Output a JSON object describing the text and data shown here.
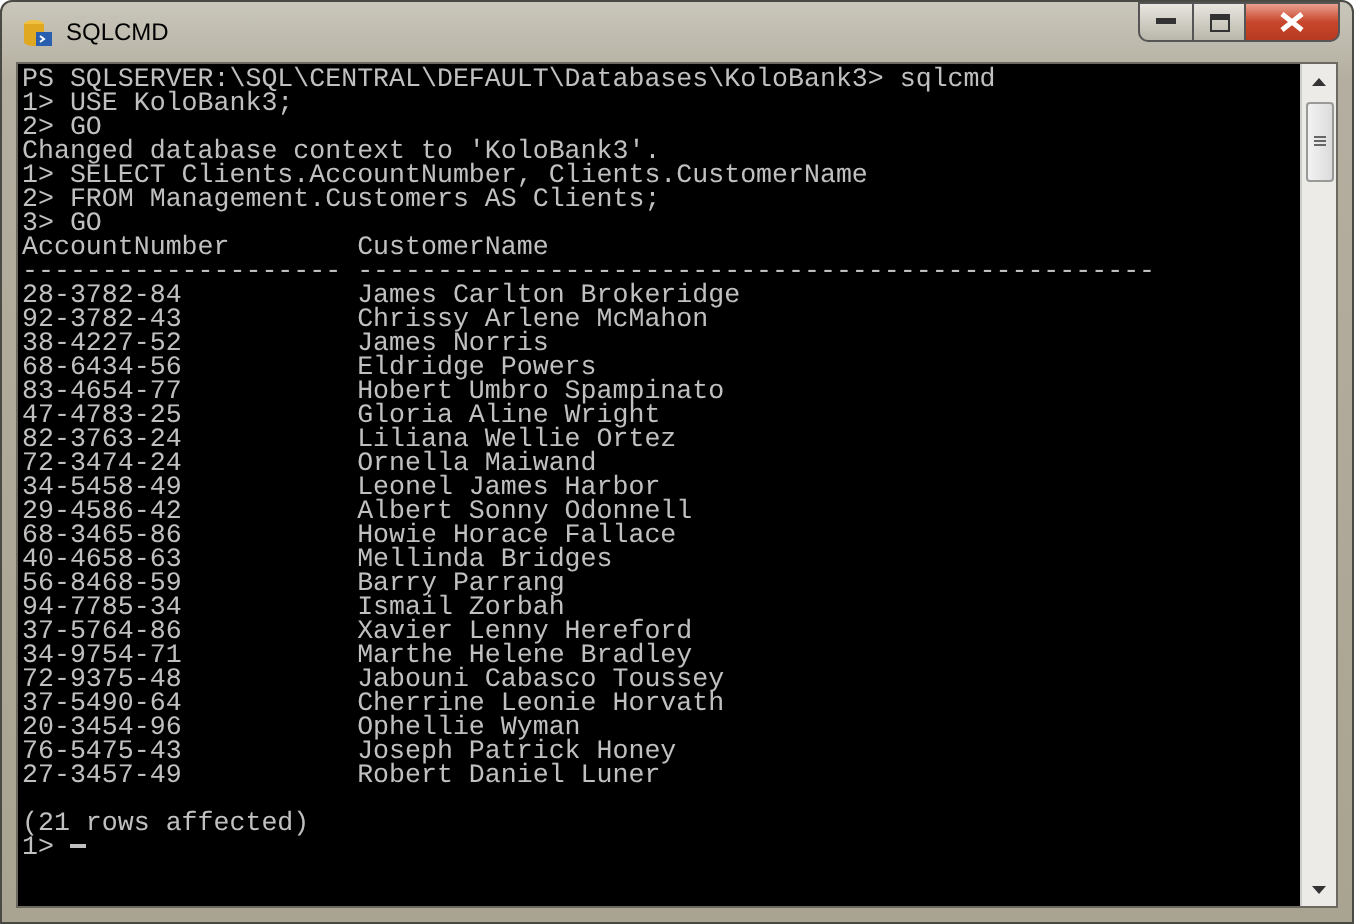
{
  "window": {
    "title": "SQLCMD"
  },
  "console": {
    "lines": [
      "PS SQLSERVER:\\SQL\\CENTRAL\\DEFAULT\\Databases\\KoloBank3> sqlcmd",
      "1> USE KoloBank3;",
      "2> GO",
      "Changed database context to 'KoloBank3'.",
      "1> SELECT Clients.AccountNumber, Clients.CustomerName",
      "2> FROM Management.Customers AS Clients;",
      "3> GO"
    ],
    "table": {
      "columns": [
        {
          "name": "AccountNumber",
          "underline": "--------------------"
        },
        {
          "name": "CustomerName",
          "underline": "--------------------------------------------------"
        }
      ],
      "rows": [
        {
          "account_number": "28-3782-84",
          "customer_name": "James Carlton Brokeridge"
        },
        {
          "account_number": "92-3782-43",
          "customer_name": "Chrissy Arlene McMahon"
        },
        {
          "account_number": "38-4227-52",
          "customer_name": "James Norris"
        },
        {
          "account_number": "68-6434-56",
          "customer_name": "Eldridge Powers"
        },
        {
          "account_number": "83-4654-77",
          "customer_name": "Hobert Umbro Spampinato"
        },
        {
          "account_number": "47-4783-25",
          "customer_name": "Gloria Aline Wright"
        },
        {
          "account_number": "82-3763-24",
          "customer_name": "Liliana Wellie Ortez"
        },
        {
          "account_number": "72-3474-24",
          "customer_name": "Ornella Maiwand"
        },
        {
          "account_number": "34-5458-49",
          "customer_name": "Leonel James Harbor"
        },
        {
          "account_number": "29-4586-42",
          "customer_name": "Albert Sonny Odonnell"
        },
        {
          "account_number": "68-3465-86",
          "customer_name": "Howie Horace Fallace"
        },
        {
          "account_number": "40-4658-63",
          "customer_name": "Mellinda Bridges"
        },
        {
          "account_number": "56-8468-59",
          "customer_name": "Barry Parrang"
        },
        {
          "account_number": "94-7785-34",
          "customer_name": "Ismail Zorbah"
        },
        {
          "account_number": "37-5764-86",
          "customer_name": "Xavier Lenny Hereford"
        },
        {
          "account_number": "34-9754-71",
          "customer_name": "Marthe Helene Bradley"
        },
        {
          "account_number": "72-9375-48",
          "customer_name": "Jabouni Cabasco Toussey"
        },
        {
          "account_number": "37-5490-64",
          "customer_name": "Cherrine Leonie Horvath"
        },
        {
          "account_number": "20-3454-96",
          "customer_name": "Ophellie Wyman"
        },
        {
          "account_number": "76-5475-43",
          "customer_name": "Joseph Patrick Honey"
        },
        {
          "account_number": "27-3457-49",
          "customer_name": "Robert Daniel Luner"
        }
      ]
    },
    "footer": "(21 rows affected)",
    "prompt": "1>"
  }
}
